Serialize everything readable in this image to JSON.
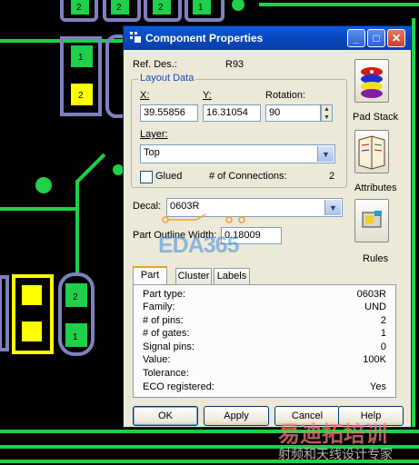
{
  "window": {
    "title": "Component Properties",
    "controls": {
      "minimize": "_",
      "maximize": "□",
      "close": "✕"
    }
  },
  "ref_des": {
    "label": "Ref. Des.:",
    "value": "R93"
  },
  "layout_data": {
    "group_title": "Layout Data",
    "x": {
      "label": "X:",
      "value": "39.55856"
    },
    "y": {
      "label": "Y:",
      "value": "16.31054"
    },
    "rotation": {
      "label": "Rotation:",
      "value": "90"
    },
    "layer": {
      "label": "Layer:",
      "value": "Top"
    },
    "glued": {
      "label": "Glued",
      "checked": false
    },
    "connections": {
      "label": "# of Connections:",
      "value": "2"
    }
  },
  "decal": {
    "label": "Decal:",
    "value": "0603R"
  },
  "outline": {
    "label": "Part Outline Width:",
    "value": "0.18009"
  },
  "side_buttons": [
    {
      "label": "Pad Stack",
      "icon": "pad-stack-icon"
    },
    {
      "label": "Attributes",
      "icon": "attributes-icon"
    },
    {
      "label": "Rules",
      "icon": "rules-icon"
    }
  ],
  "tabs": [
    {
      "label": "Part",
      "active": true
    },
    {
      "label": "Cluster",
      "active": false
    },
    {
      "label": "Labels",
      "active": false
    }
  ],
  "part_info": [
    {
      "key": "Part type:",
      "value": "0603R"
    },
    {
      "key": "Family:",
      "value": "UND"
    },
    {
      "key": "# of pins:",
      "value": "2"
    },
    {
      "key": "# of gates:",
      "value": "1"
    },
    {
      "key": "Signal pins:",
      "value": "0"
    },
    {
      "key": "Value:",
      "value": "100K"
    },
    {
      "key": "Tolerance:",
      "value": ""
    },
    {
      "key": "ECO registered:",
      "value": "Yes"
    }
  ],
  "buttons": {
    "ok": "OK",
    "apply": "Apply",
    "cancel": "Cancel",
    "help": "Help"
  },
  "pcb_labels": {
    "pin1": "1",
    "pin2": "2"
  },
  "watermarks": {
    "eda": "EDA365",
    "cn_big": "易迪拓培训",
    "cn_small": "射频和天线设计专家"
  },
  "colors": {
    "trace": "#1fd04a",
    "pad": "#1fd04a",
    "pad_selected": "#ffff00",
    "outline": "#8080c0",
    "title_bar": "#0a5ad8",
    "dialog_bg": "#ece9d8"
  }
}
